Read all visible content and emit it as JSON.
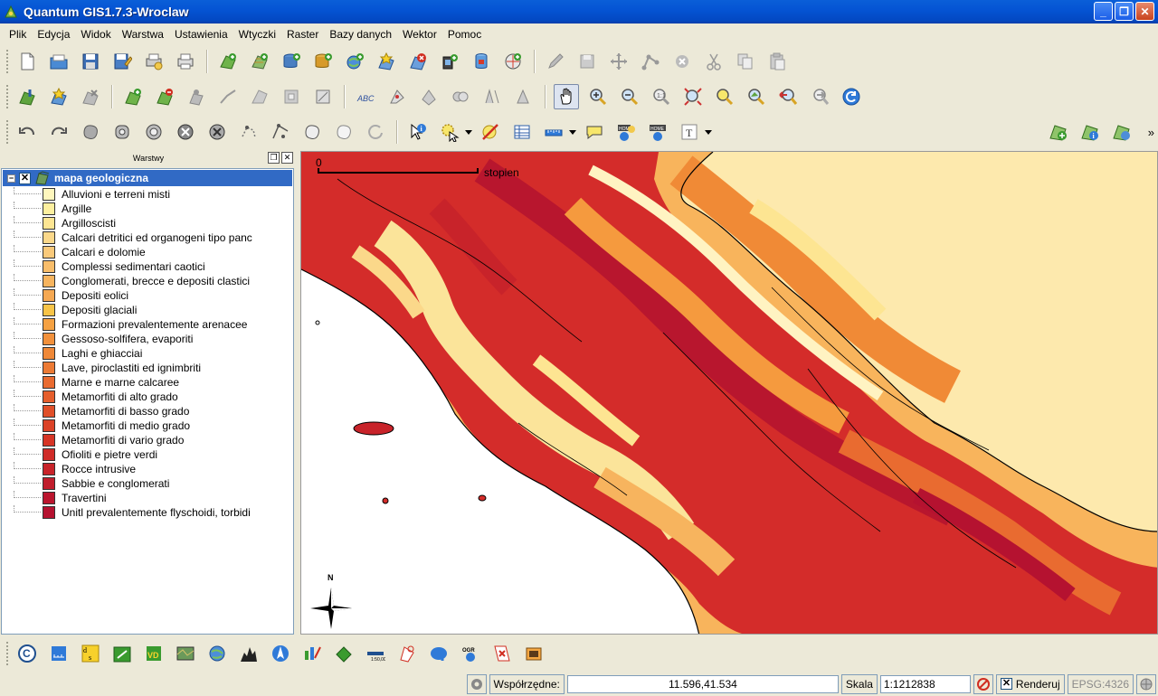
{
  "window": {
    "title": "Quantum GIS1.7.3-Wroclaw"
  },
  "menu": [
    "Plik",
    "Edycja",
    "Widok",
    "Warstwa",
    "Ustawienia",
    "Wtyczki",
    "Raster",
    "Bazy danych",
    "Wektor",
    "Pomoc"
  ],
  "layers_panel": {
    "title": "Warstwy",
    "layer_name": "mapa geologiczna",
    "legend": [
      {
        "label": "Alluvioni e terreni misti",
        "color": "#fff7bd"
      },
      {
        "label": "Argille",
        "color": "#fdef9f"
      },
      {
        "label": "Argilloscisti",
        "color": "#fde592"
      },
      {
        "label": "Calcari detritici ed organogeni tipo panc",
        "color": "#fbd88a"
      },
      {
        "label": "Calcari e dolomie",
        "color": "#f9c97a"
      },
      {
        "label": "Complessi sedimentari caotici",
        "color": "#f8bd6a"
      },
      {
        "label": "Conglomerati, brecce e depositi clastici",
        "color": "#f7b45e"
      },
      {
        "label": "Depositi eolici",
        "color": "#f5a852"
      },
      {
        "label": "Depositi glaciali",
        "color": "#f8c448"
      },
      {
        "label": "Formazioni prevalentemente arenacee",
        "color": "#f5a142"
      },
      {
        "label": "Gessoso-solfifera, evaporiti",
        "color": "#f2913c"
      },
      {
        "label": "Laghi e ghiacciai",
        "color": "#ef8838"
      },
      {
        "label": "Lave, piroclastiti ed ignimbriti",
        "color": "#ec7a34"
      },
      {
        "label": "Marne e marne calcaree",
        "color": "#e96b30"
      },
      {
        "label": "Metamorfiti di alto grado",
        "color": "#e55e2c"
      },
      {
        "label": "Metamorfiti di basso grado",
        "color": "#e04f29"
      },
      {
        "label": "Metamorfiti di medio grado",
        "color": "#db4227"
      },
      {
        "label": "Metamorfiti di vario grado",
        "color": "#d63526"
      },
      {
        "label": "Ofioliti e pietre verdi",
        "color": "#cf2b28"
      },
      {
        "label": "Rocce intrusive",
        "color": "#c8232a"
      },
      {
        "label": "Sabbie e conglomerati",
        "color": "#c01d2c"
      },
      {
        "label": "Travertini",
        "color": "#bb162e"
      },
      {
        "label": "Unitl prevalentemente flyschoidi, torbidi",
        "color": "#b51230"
      }
    ]
  },
  "map": {
    "scale_zero": "0",
    "scale_unit": "stopien",
    "north_label": "N"
  },
  "statusbar": {
    "coords_label": "Współrzędne:",
    "coords_value": "11.596,41.534",
    "scale_label": "Skala",
    "scale_value": "1:1212838",
    "render_label": "Renderuj",
    "crs": "EPSG:4326"
  },
  "toolbar_icons": {
    "file": [
      "new-project-icon",
      "open-project-icon",
      "save-project-icon",
      "save-as-icon",
      "print-composer-icon",
      "print-icon"
    ],
    "layers": [
      "add-vector-icon",
      "add-raster-icon",
      "add-postgis-icon",
      "add-spatialite-icon",
      "add-wms-icon",
      "new-layer-icon",
      "remove-layer-icon",
      "add-wfs-icon",
      "add-sql-icon",
      "add-gps-icon"
    ],
    "edit": [
      "toggle-edit-icon",
      "save-edits-icon",
      "move-feature-icon",
      "node-tool-icon",
      "delete-selected-icon",
      "cut-icon",
      "copy-icon",
      "paste-icon"
    ],
    "digitize": [
      "add-point-icon",
      "add-line-icon",
      "add-polygon-icon"
    ],
    "nav": [
      "pan-icon",
      "zoom-in-icon",
      "zoom-out-icon",
      "zoom-full-icon",
      "zoom-selection-icon",
      "zoom-layer-icon",
      "zoom-actual-icon",
      "zoom-last-icon",
      "zoom-next-icon",
      "refresh-icon"
    ]
  }
}
